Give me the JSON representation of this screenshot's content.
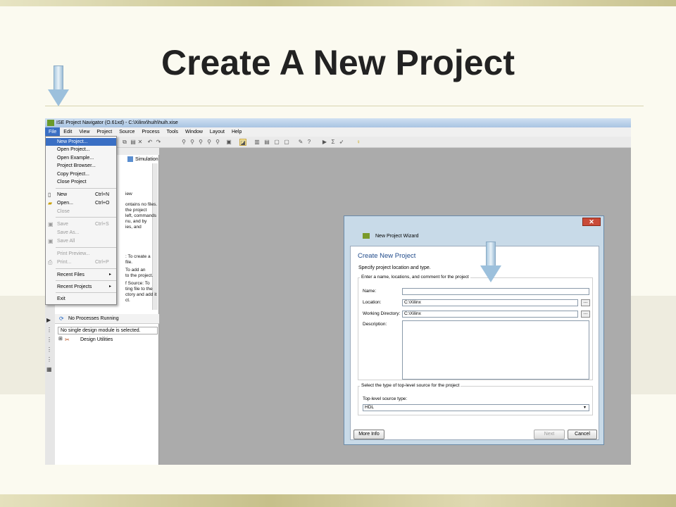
{
  "slide": {
    "title": "Create A New Project"
  },
  "app": {
    "window_title": "ISE Project Navigator (O.61xd) - C:\\Xilinx\\huih\\huih.xise",
    "menus": [
      "File",
      "Edit",
      "View",
      "Project",
      "Source",
      "Process",
      "Tools",
      "Window",
      "Layout",
      "Help"
    ],
    "file_menu": [
      {
        "label": "New Project...",
        "highlighted": true
      },
      {
        "label": "Open Project..."
      },
      {
        "label": "Open Example..."
      },
      {
        "label": "Project Browser..."
      },
      {
        "label": "Copy Project..."
      },
      {
        "label": "Close Project"
      },
      {
        "label": "New",
        "shortcut": "Ctrl+N"
      },
      {
        "label": "Open...",
        "shortcut": "Ctrl+O"
      },
      {
        "label": "Close",
        "disabled": true
      },
      {
        "label": "Save",
        "shortcut": "Ctrl+S",
        "disabled": true
      },
      {
        "label": "Save As...",
        "disabled": true
      },
      {
        "label": "Save All",
        "disabled": true
      },
      {
        "label": "Print Preview...",
        "disabled": true
      },
      {
        "label": "Print...",
        "shortcut": "Ctrl+P",
        "disabled": true
      },
      {
        "label": "Recent Files",
        "submenu": "▸"
      },
      {
        "label": "Recent Projects",
        "submenu": "▸"
      },
      {
        "label": "Exit"
      }
    ],
    "panel": {
      "simulation": "Simulation",
      "fragments": [
        "iew",
        "ontains no files.",
        "the project",
        "left, commands",
        "nu, and by",
        "ies, and",
        ": To create a",
        "file.",
        "To add an",
        "to the project.",
        "f Source: To",
        "ting file to the",
        "ctory and add it",
        "ct."
      ],
      "processes": "No Processes Running",
      "design_select": "No single design module is selected.",
      "design_utilities": "Design Utilities"
    },
    "wizard": {
      "window_title": "New Project Wizard",
      "close": "✕",
      "heading": "Create New Project",
      "subtitle": "Specify project location and type.",
      "group1_label": "Enter a name, locations, and comment for the project",
      "name_label": "Name:",
      "name_value": "",
      "location_label": "Location:",
      "location_value": "C:\\Xilinx",
      "workdir_label": "Working Directory:",
      "workdir_value": "C:\\Xilinx",
      "description_label": "Description:",
      "browse": "...",
      "group2_label": "Select the type of top-level source for the project",
      "toplevel_label": "Top-level source type:",
      "toplevel_value": "HDL",
      "more_info": "More Info",
      "next": "Next",
      "cancel": "Cancel"
    }
  }
}
